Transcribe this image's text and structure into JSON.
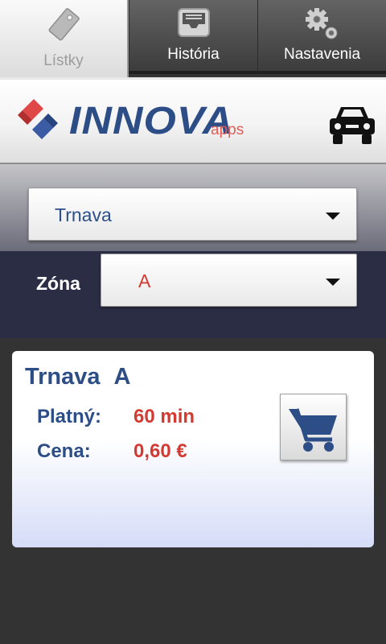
{
  "tabs": [
    {
      "label": "Lístky",
      "icon": "ticket-icon",
      "active": true
    },
    {
      "label": "História",
      "icon": "inbox-tray-icon",
      "active": false
    },
    {
      "label": "Nastavenia",
      "icon": "gears-icon",
      "active": false
    }
  ],
  "header": {
    "logo_text": "INNOVA",
    "logo_sub": "apps",
    "car_icon": "car-icon"
  },
  "selector": {
    "city_value": "Trnava",
    "zone_label": "Zóna",
    "zone_value": "A"
  },
  "ticket": {
    "title": "Trnava A",
    "valid_label": "Platný:",
    "valid_value": "60 min",
    "price_label": "Cena:",
    "price_value": "0,60 €",
    "cart_icon": "shopping-cart-icon"
  },
  "colors": {
    "brand_blue": "#2c4d86",
    "accent_red": "#d23a32",
    "logo_red": "#e25c55",
    "background": "#333334"
  }
}
